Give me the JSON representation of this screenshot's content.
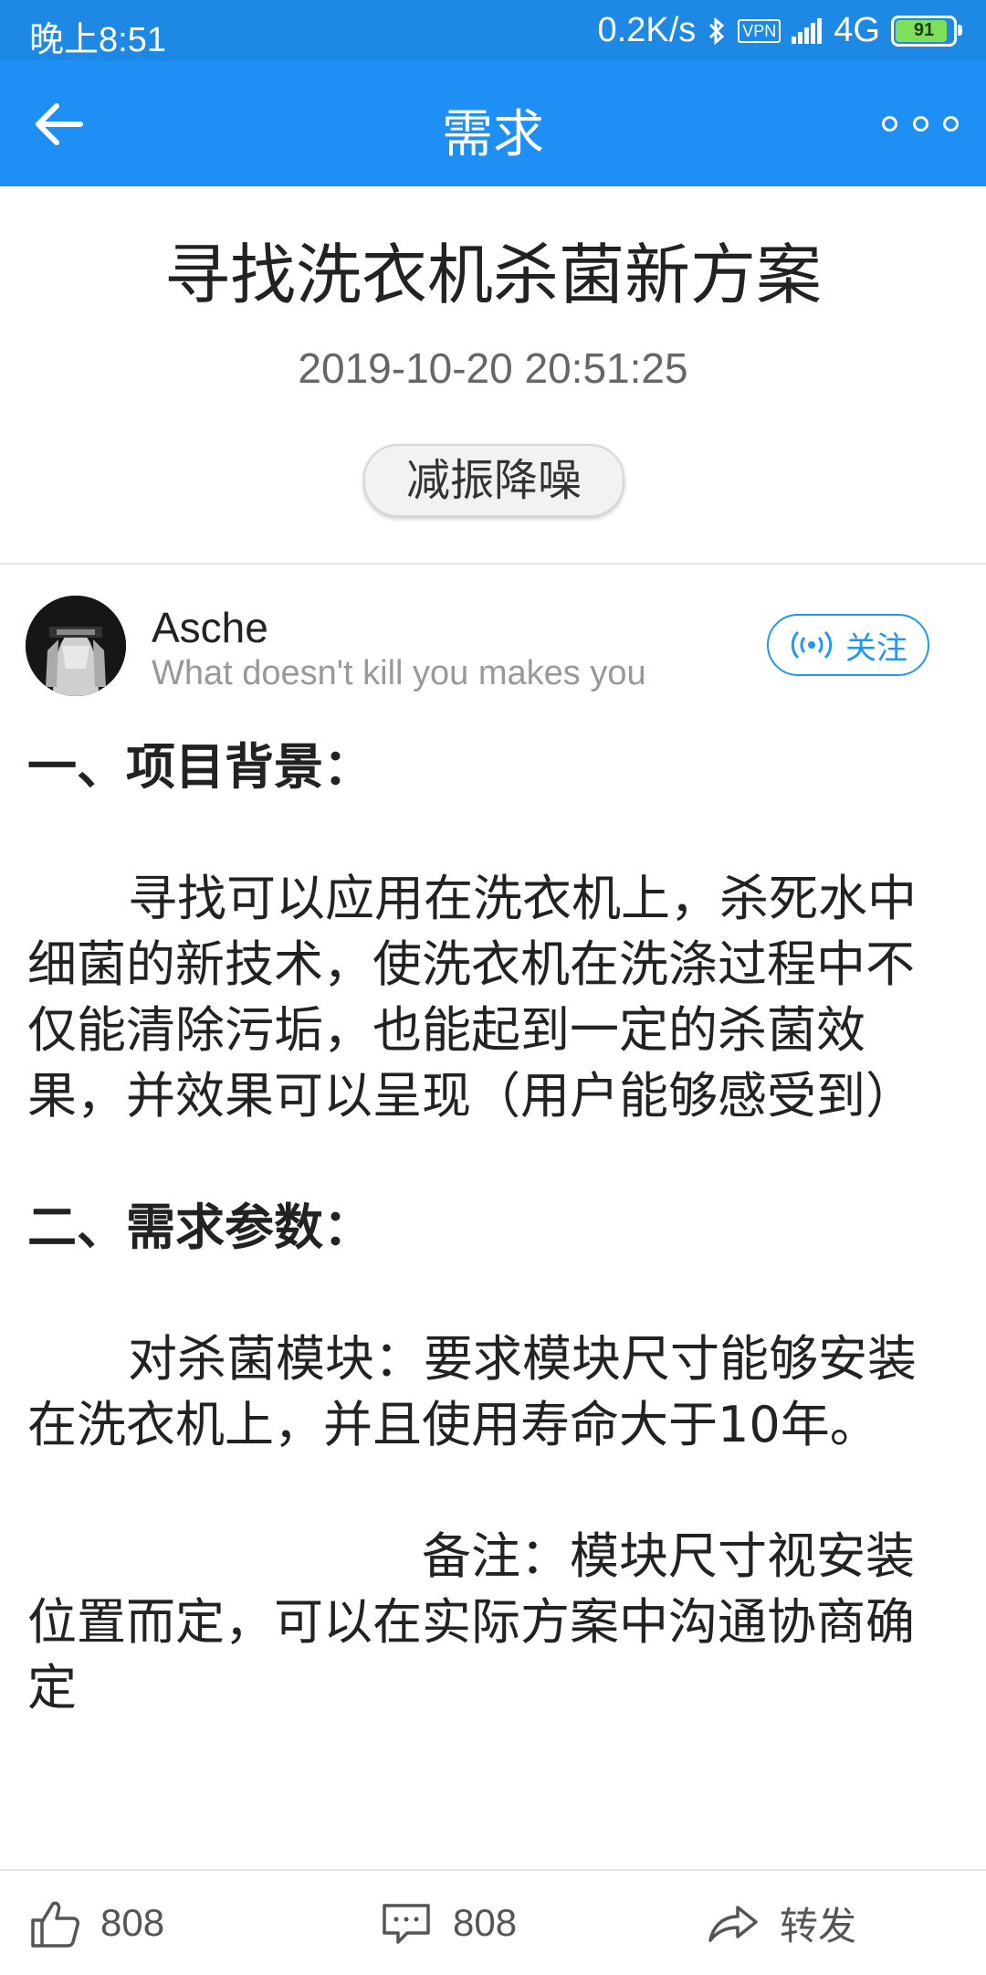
{
  "status_bar": {
    "time": "晚上8:51",
    "speed": "0.2K/s",
    "vpn": "VPN",
    "network": "4G",
    "battery": "91",
    "battery_level": 0.91
  },
  "app_bar": {
    "title": "需求"
  },
  "article": {
    "title": "寻找洗衣机杀菌新方案",
    "datetime": "2019-10-20 20:51:25",
    "tag": "减振降噪"
  },
  "author": {
    "name": "Asche",
    "signature": "What doesn't kill you makes you",
    "follow_label": "关注"
  },
  "content": {
    "heading1": "一、项目背景：",
    "paragraph1": "寻找可以应用在洗衣机上，杀死水中细菌的新技术，使洗衣机在洗涤过程中不仅能清除污垢，也能起到一定的杀菌效果，并效果可以呈现（用户能够感受到）",
    "heading2": "二、需求参数：",
    "paragraph2": "对杀菌模块：要求模块尺寸能够安装在洗衣机上，并且使用寿命大于10年。",
    "paragraph3": "备注：模块尺寸视安装位置而定，可以在实际方案中沟通协商确定"
  },
  "bottom_bar": {
    "likes": "808",
    "comments": "808",
    "share_label": "转发"
  },
  "colors": {
    "primary": "#1e90f5",
    "accent": "#2196f3"
  }
}
